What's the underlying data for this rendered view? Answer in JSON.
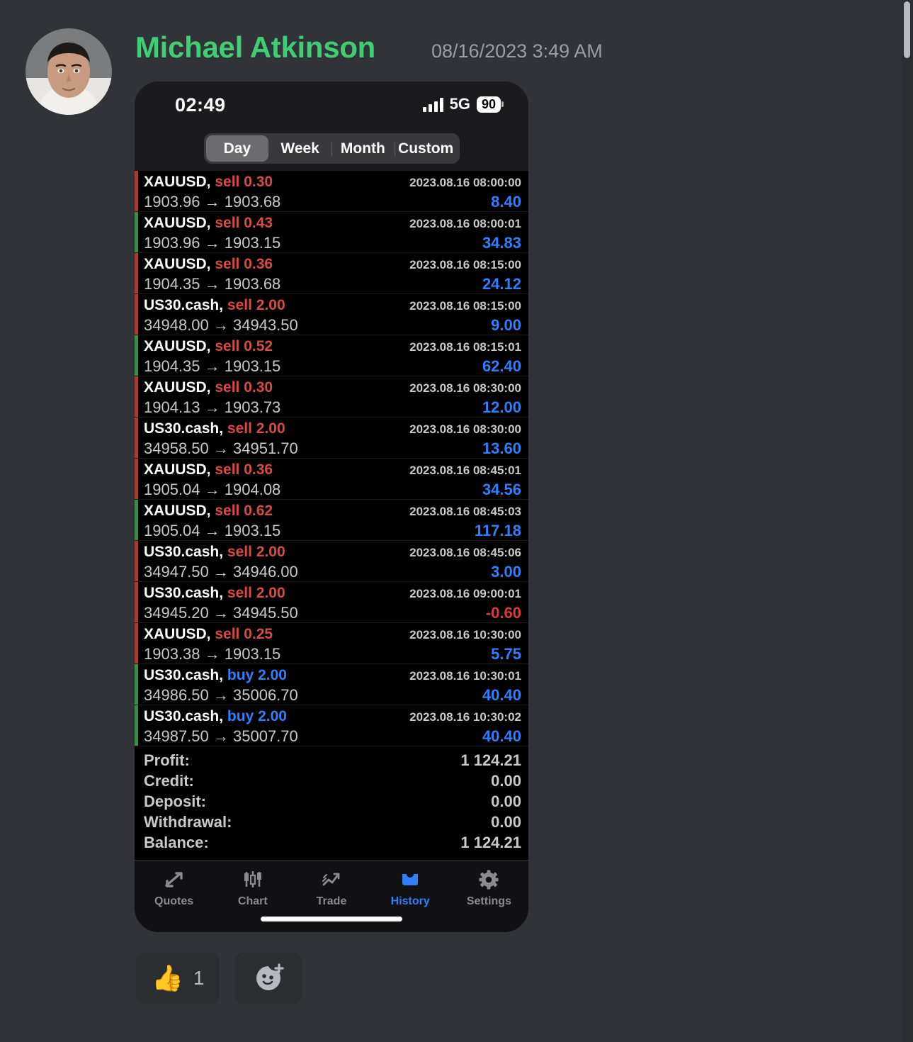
{
  "message": {
    "author": "Michael Atkinson",
    "timestamp": "08/16/2023 3:49 AM",
    "author_color": "#3fce73",
    "avatar_name": "user-avatar"
  },
  "phone": {
    "status_bar": {
      "time": "02:49",
      "network": "5G",
      "battery": "90",
      "signal_icon": "signal-bars-icon"
    },
    "segmented_control": {
      "options": [
        "Day",
        "Week",
        "Month",
        "Custom"
      ],
      "selected": "Day"
    },
    "deals": [
      {
        "symbol": "XAUUSD,",
        "direction": "sell",
        "volume": "0.30",
        "time": "2023.08.16 08:00:00",
        "open": "1903.96",
        "close": "1903.68",
        "profit": "8.40",
        "profit_sign": "pos",
        "bar": "sell"
      },
      {
        "symbol": "XAUUSD,",
        "direction": "sell",
        "volume": "0.43",
        "time": "2023.08.16 08:00:01",
        "open": "1903.96",
        "close": "1903.15",
        "profit": "34.83",
        "profit_sign": "pos",
        "bar": "buy"
      },
      {
        "symbol": "XAUUSD,",
        "direction": "sell",
        "volume": "0.36",
        "time": "2023.08.16 08:15:00",
        "open": "1904.35",
        "close": "1903.68",
        "profit": "24.12",
        "profit_sign": "pos",
        "bar": "sell"
      },
      {
        "symbol": "US30.cash,",
        "direction": "sell",
        "volume": "2.00",
        "time": "2023.08.16 08:15:00",
        "open": "34948.00",
        "close": "34943.50",
        "profit": "9.00",
        "profit_sign": "pos",
        "bar": "sell"
      },
      {
        "symbol": "XAUUSD,",
        "direction": "sell",
        "volume": "0.52",
        "time": "2023.08.16 08:15:01",
        "open": "1904.35",
        "close": "1903.15",
        "profit": "62.40",
        "profit_sign": "pos",
        "bar": "buy"
      },
      {
        "symbol": "XAUUSD,",
        "direction": "sell",
        "volume": "0.30",
        "time": "2023.08.16 08:30:00",
        "open": "1904.13",
        "close": "1903.73",
        "profit": "12.00",
        "profit_sign": "pos",
        "bar": "sell"
      },
      {
        "symbol": "US30.cash,",
        "direction": "sell",
        "volume": "2.00",
        "time": "2023.08.16 08:30:00",
        "open": "34958.50",
        "close": "34951.70",
        "profit": "13.60",
        "profit_sign": "pos",
        "bar": "sell"
      },
      {
        "symbol": "XAUUSD,",
        "direction": "sell",
        "volume": "0.36",
        "time": "2023.08.16 08:45:01",
        "open": "1905.04",
        "close": "1904.08",
        "profit": "34.56",
        "profit_sign": "pos",
        "bar": "sell"
      },
      {
        "symbol": "XAUUSD,",
        "direction": "sell",
        "volume": "0.62",
        "time": "2023.08.16 08:45:03",
        "open": "1905.04",
        "close": "1903.15",
        "profit": "117.18",
        "profit_sign": "pos",
        "bar": "buy"
      },
      {
        "symbol": "US30.cash,",
        "direction": "sell",
        "volume": "2.00",
        "time": "2023.08.16 08:45:06",
        "open": "34947.50",
        "close": "34946.00",
        "profit": "3.00",
        "profit_sign": "pos",
        "bar": "sell"
      },
      {
        "symbol": "US30.cash,",
        "direction": "sell",
        "volume": "2.00",
        "time": "2023.08.16 09:00:01",
        "open": "34945.20",
        "close": "34945.50",
        "profit": "-0.60",
        "profit_sign": "neg",
        "bar": "sell"
      },
      {
        "symbol": "XAUUSD,",
        "direction": "sell",
        "volume": "0.25",
        "time": "2023.08.16 10:30:00",
        "open": "1903.38",
        "close": "1903.15",
        "profit": "5.75",
        "profit_sign": "pos",
        "bar": "sell"
      },
      {
        "symbol": "US30.cash,",
        "direction": "buy",
        "volume": "2.00",
        "time": "2023.08.16 10:30:01",
        "open": "34986.50",
        "close": "35006.70",
        "profit": "40.40",
        "profit_sign": "pos",
        "bar": "buy"
      },
      {
        "symbol": "US30.cash,",
        "direction": "buy",
        "volume": "2.00",
        "time": "2023.08.16 10:30:02",
        "open": "34987.50",
        "close": "35007.70",
        "profit": "40.40",
        "profit_sign": "pos",
        "bar": "buy"
      }
    ],
    "summary": [
      {
        "label": "Profit:",
        "value": "1 124.21"
      },
      {
        "label": "Credit:",
        "value": "0.00"
      },
      {
        "label": "Deposit:",
        "value": "0.00"
      },
      {
        "label": "Withdrawal:",
        "value": "0.00"
      },
      {
        "label": "Balance:",
        "value": "1 124.21"
      }
    ],
    "tabs": [
      {
        "label": "Quotes",
        "icon": "quotes-arrows-icon",
        "active": false
      },
      {
        "label": "Chart",
        "icon": "candlestick-chart-icon",
        "active": false
      },
      {
        "label": "Trade",
        "icon": "trade-trend-arrow-icon",
        "active": false
      },
      {
        "label": "History",
        "icon": "history-inbox-icon",
        "active": true
      },
      {
        "label": "Settings",
        "icon": "gear-icon",
        "active": false
      }
    ],
    "active_tab_color": "#2f7fff"
  },
  "reactions": {
    "thumbs_up": {
      "emoji": "👍",
      "count": "1"
    },
    "add_label": "add-reaction"
  }
}
